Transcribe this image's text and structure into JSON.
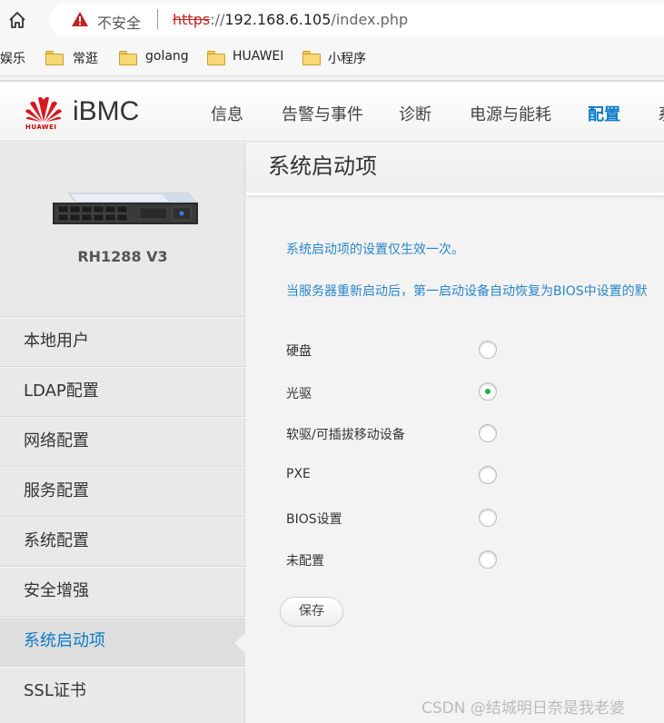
{
  "browser": {
    "security_label": "不安全",
    "url_protocol": "https",
    "url_rest": "://",
    "url_host": "192.168.6.105",
    "url_path": "/index.php",
    "bookmarks": [
      "娱乐",
      "常逛",
      "golang",
      "HUAWEI",
      "小程序"
    ]
  },
  "header": {
    "logo_text": "iBMC",
    "logo_brand": "HUAWEI",
    "nav": [
      "信息",
      "告警与事件",
      "诊断",
      "电源与能耗",
      "配置",
      "系"
    ],
    "active_nav": "配置"
  },
  "sidebar": {
    "model": "RH1288 V3",
    "items": [
      "本地用户",
      "LDAP配置",
      "网络配置",
      "服务配置",
      "系统配置",
      "安全增强",
      "系统启动项",
      "SSL证书"
    ],
    "active_item": "系统启动项"
  },
  "main": {
    "title": "系统启动项",
    "info_1": "系统启动项的设置仅生效一次。",
    "info_2": "当服务器重新启动后，第一启动设备自动恢复为BIOS中设置的默",
    "options": [
      {
        "label": "硬盘",
        "selected": false
      },
      {
        "label": "光驱",
        "selected": true
      },
      {
        "label": "软驱/可插拔移动设备",
        "selected": false
      },
      {
        "label": "PXE",
        "selected": false
      },
      {
        "label": "BIOS设置",
        "selected": false
      },
      {
        "label": "未配置",
        "selected": false
      }
    ],
    "save_label": "保存"
  },
  "watermark": "CSDN @结城明日奈是我老婆",
  "colors": {
    "accent": "#0a7bc8",
    "info_text": "#2a86c9",
    "radio_selected": "#1bae5b",
    "insecure_red": "#c5221f",
    "huawei_red": "#cc0000"
  }
}
